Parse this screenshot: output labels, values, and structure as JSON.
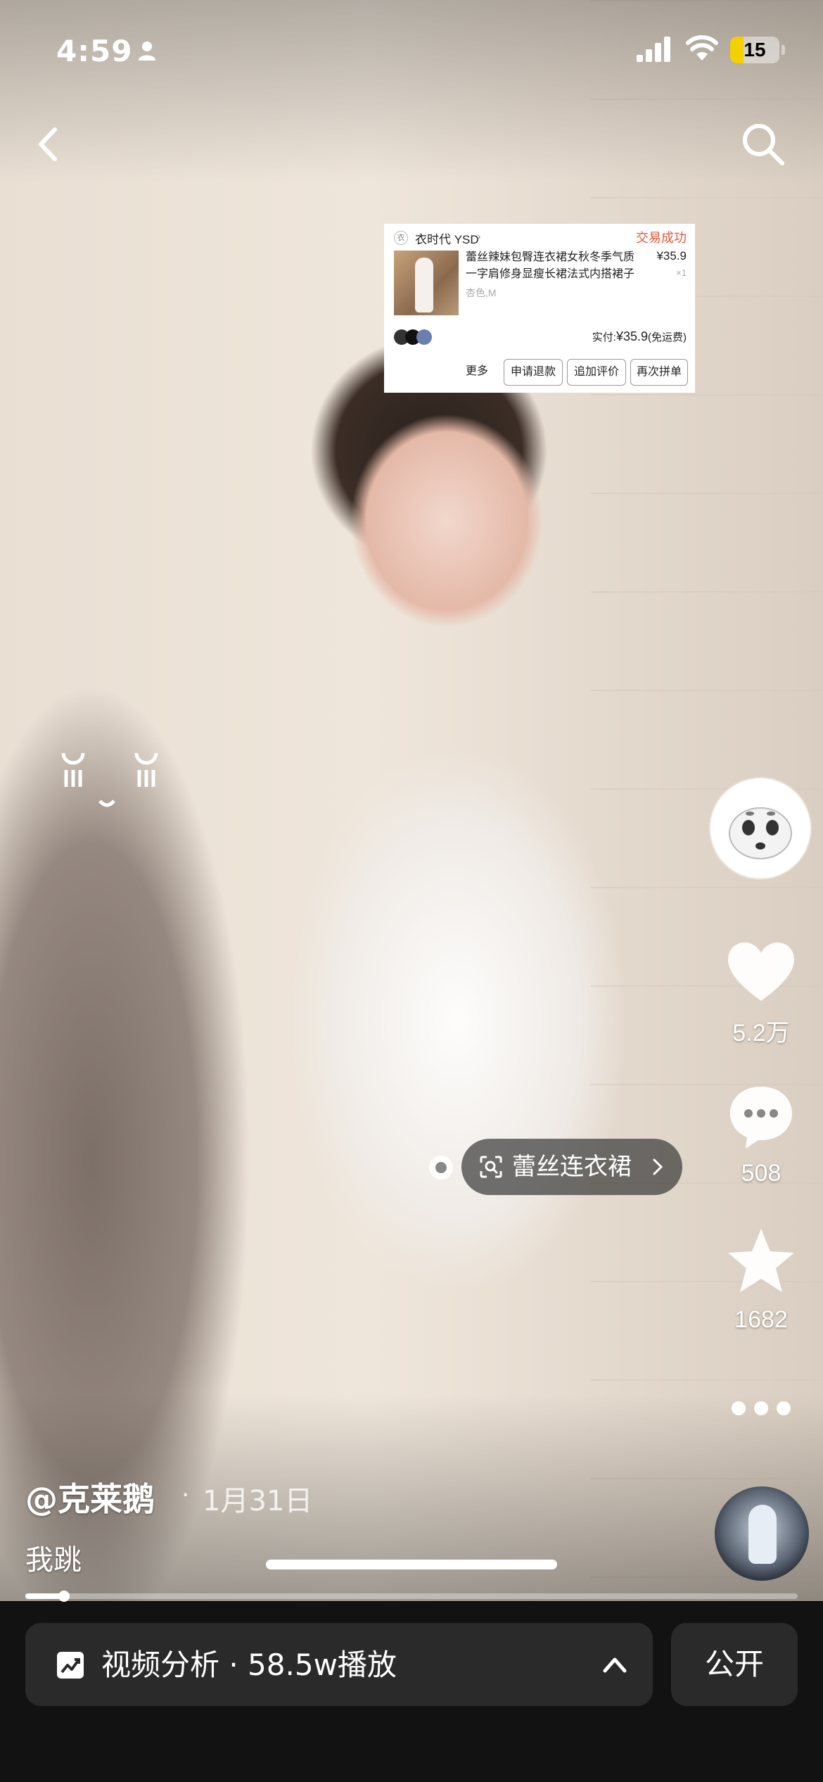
{
  "status_bar": {
    "time": "4:59",
    "battery": "15",
    "battery_level": 0.15
  },
  "order_card": {
    "shop_logo": "衣",
    "shop_name": "衣时代 YSD",
    "status": "交易成功",
    "title": "蕾丝辣妹包臀连衣裙女秋冬季气质一字肩修身显瘦长裙法式内搭裙子",
    "price": "¥35.9",
    "quantity": "×1",
    "spec": "杏色,M",
    "paid_prefix": "实付:",
    "paid_amount": "¥35.9",
    "paid_suffix": "(免运费)",
    "actions": [
      "更多",
      "申请退款",
      "追加评价",
      "再次拼单"
    ]
  },
  "actions": {
    "like_count": "5.2万",
    "comment_count": "508",
    "favorite_count": "1682"
  },
  "product_tag": {
    "label": "蕾丝连衣裙"
  },
  "video": {
    "author": "@克莱鹅",
    "separator": "·",
    "date": "1月31日",
    "caption": "我跳",
    "progress": 0.05
  },
  "bottom_bar": {
    "analysis_label": "视频分析 · 58.5w播放",
    "public_label": "公开"
  },
  "colors": {
    "accent_status": "#e05a3a",
    "battery_fill": "#f5d000",
    "bottom_bg": "#121212",
    "bar_bg": "#2a2a2a"
  },
  "icons": [
    "person-icon",
    "signal-icon",
    "wifi-icon",
    "back-icon",
    "search-icon",
    "heart-icon",
    "comment-icon",
    "star-icon",
    "more-icon",
    "scan-icon",
    "chevron-right-icon",
    "chart-icon",
    "chevron-up-icon"
  ]
}
